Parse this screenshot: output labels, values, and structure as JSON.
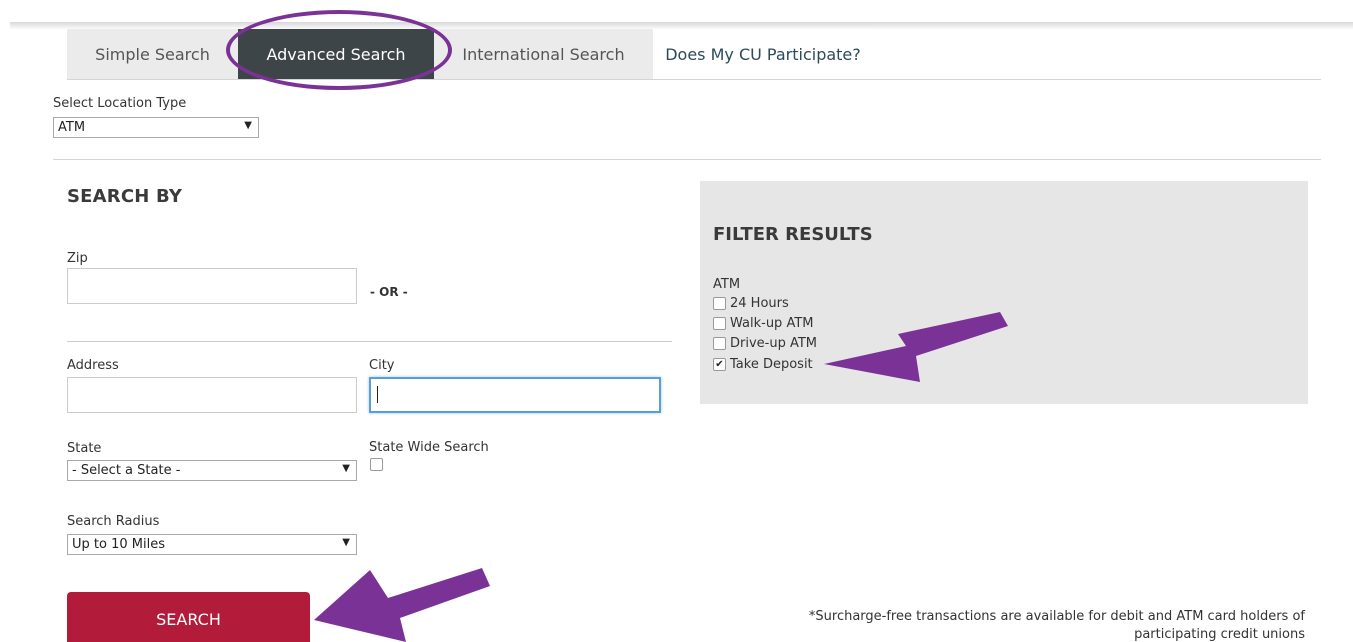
{
  "tabs": {
    "simple": "Simple Search",
    "advanced": "Advanced Search",
    "international": "International Search",
    "participate": "Does My CU Participate?"
  },
  "location": {
    "label": "Select Location Type",
    "selected": "ATM"
  },
  "search_by": {
    "title": "SEARCH BY",
    "zip_label": "Zip",
    "zip_value": "",
    "or_text": "- OR -",
    "address_label": "Address",
    "address_value": "",
    "city_label": "City",
    "city_value": "",
    "state_label": "State",
    "state_selected": "- Select a State -",
    "statewide_label": "State Wide Search",
    "statewide_checked": false,
    "radius_label": "Search Radius",
    "radius_selected": "Up to 10 Miles",
    "search_button": "SEARCH"
  },
  "filter": {
    "title": "FILTER RESULTS",
    "subtitle": "ATM",
    "items": [
      {
        "label": "24 Hours",
        "checked": false
      },
      {
        "label": "Walk-up ATM",
        "checked": false
      },
      {
        "label": "Drive-up ATM",
        "checked": false
      },
      {
        "label": "Take Deposit",
        "checked": true
      }
    ]
  },
  "footnote": {
    "line1": "*Surcharge-free transactions are available for debit and ATM card holders of",
    "line2": "participating credit unions"
  },
  "colors": {
    "active_tab": "#3e4548",
    "search_button": "#b31b3b",
    "annotation": "#7b3296",
    "filter_panel": "#e6e6e6"
  }
}
